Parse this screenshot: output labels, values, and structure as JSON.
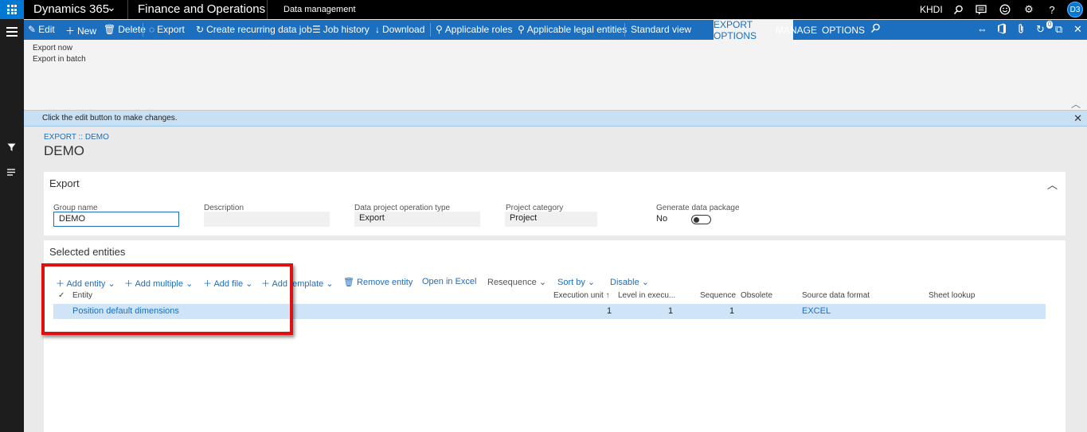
{
  "top_nav": {
    "brand": "Dynamics 365",
    "module": "Finance and Operations",
    "workspace": "Data management",
    "company": "KHDI",
    "user_initials": "D3"
  },
  "action_pane": {
    "edit": "Edit",
    "new": "New",
    "delete": "Delete",
    "export": "Export",
    "create_recurring": "Create recurring data job",
    "job_history": "Job history",
    "download": "Download",
    "applicable_roles": "Applicable roles",
    "applicable_legal_entities": "Applicable legal entities",
    "standard_view": "Standard view",
    "tabs": [
      "EXPORT OPTIONS",
      "MANAGE",
      "OPTIONS"
    ],
    "notification_count": "0"
  },
  "flyout": {
    "items": [
      "Export now",
      "Export in batch"
    ]
  },
  "message_bar": {
    "text": "Click the edit button to make changes."
  },
  "page": {
    "breadcrumb": "EXPORT :: DEMO",
    "title": "DEMO"
  },
  "export_section": {
    "title": "Export",
    "fields": {
      "group_name": {
        "label": "Group name",
        "value": "DEMO"
      },
      "description": {
        "label": "Description",
        "value": ""
      },
      "operation_type": {
        "label": "Data project operation type",
        "value": "Export"
      },
      "project_category": {
        "label": "Project category",
        "value": "Project"
      },
      "generate_package": {
        "label": "Generate data package",
        "value": "No"
      }
    }
  },
  "entities_section": {
    "title": "Selected entities",
    "toolbar": {
      "add_entity": "Add entity",
      "add_multiple": "Add multiple",
      "add_file": "Add file",
      "add_template": "Add template",
      "remove_entity": "Remove entity",
      "open_in_excel": "Open in Excel",
      "resequence": "Resequence",
      "sort_by": "Sort by",
      "disable": "Disable"
    },
    "columns": {
      "entity": "Entity",
      "execution_unit": "Execution unit",
      "level": "Level in execu...",
      "sequence": "Sequence",
      "obsolete": "Obsolete",
      "source_format": "Source data format",
      "sheet_lookup": "Sheet lookup"
    },
    "rows": [
      {
        "entity": "Position default dimensions",
        "execution_unit": "1",
        "level": "1",
        "sequence": "1",
        "obsolete": "",
        "source_format": "EXCEL",
        "sheet_lookup": ""
      }
    ]
  },
  "colors": {
    "accent": "#1c6ebf",
    "top_bar": "#000000",
    "highlight": "#e01010",
    "selected_row": "#cfe4f7"
  }
}
